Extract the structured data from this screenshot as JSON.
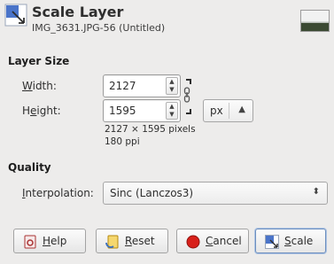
{
  "header": {
    "title": "Scale Layer",
    "subtitle": "IMG_3631.JPG-56 (Untitled)"
  },
  "layer_size": {
    "section_label": "Layer Size",
    "width": {
      "label_key": "W",
      "label_rest": "idth:",
      "value": "2127"
    },
    "height": {
      "label_pre": "H",
      "label_key": "e",
      "label_rest": "ight:",
      "value": "1595"
    },
    "unit": "px",
    "dimensions_text": "2127 × 1595 pixels",
    "resolution_text": "180 ppi"
  },
  "quality": {
    "section_label": "Quality",
    "interpolation": {
      "label_key": "I",
      "label_rest": "nterpolation:",
      "value": "Sinc (Lanczos3)"
    }
  },
  "buttons": {
    "help": {
      "key": "H",
      "rest": "elp"
    },
    "reset": {
      "key": "R",
      "rest": "eset"
    },
    "cancel": {
      "key": "C",
      "rest": "ancel"
    },
    "scale": {
      "key": "S",
      "rest": "cale"
    }
  },
  "colors": {
    "background": "#edeceb",
    "default_button_border": "#6d8fbf",
    "cancel_icon": "#d8201a"
  }
}
